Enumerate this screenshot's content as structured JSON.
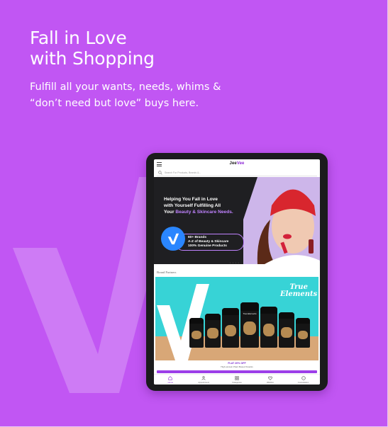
{
  "headline": {
    "line1": "Fall in Love",
    "line2": "with Shopping"
  },
  "subheadline": {
    "line1": "Fulfill all your wants, needs, whims &",
    "line2": "“don’t need but love” buys here."
  },
  "colors": {
    "background": "#c156f3",
    "accent": "#8e2ad6",
    "promo_bg": "#37d3d6"
  },
  "app": {
    "logo_main": "Jee",
    "logo_accent": "Vee",
    "search_placeholder": "Search For Products, Brands &...",
    "hero": {
      "line1": "Helping You Fall in Love",
      "line2": "with Yourself Fulfilling All",
      "line3_prefix": "Your ",
      "line3_highlight": "Beauty & Skincare Needs.",
      "badge_line1": "60+ Brands",
      "badge_line2": "A-Z of Beauty & Skincare",
      "badge_line3": "100% Genuine Products"
    },
    "section_label": "Brand Partners",
    "promo": {
      "brand_line1": "True",
      "brand_line2": "Elements",
      "jar_label": "True Elements",
      "offer_line1": "FLAT 20% OFF",
      "offer_line2": "High-protein Plant Based Snacks"
    },
    "bottom_nav": [
      {
        "label": "Home",
        "icon": "home-icon",
        "active": true
      },
      {
        "label": "Appointment",
        "icon": "appointment-icon",
        "active": false
      },
      {
        "label": "Categories",
        "icon": "categories-icon",
        "active": false
      },
      {
        "label": "Wishlist",
        "icon": "heart-icon",
        "active": false
      },
      {
        "label": "Consultation",
        "icon": "chat-icon",
        "active": false
      }
    ]
  }
}
